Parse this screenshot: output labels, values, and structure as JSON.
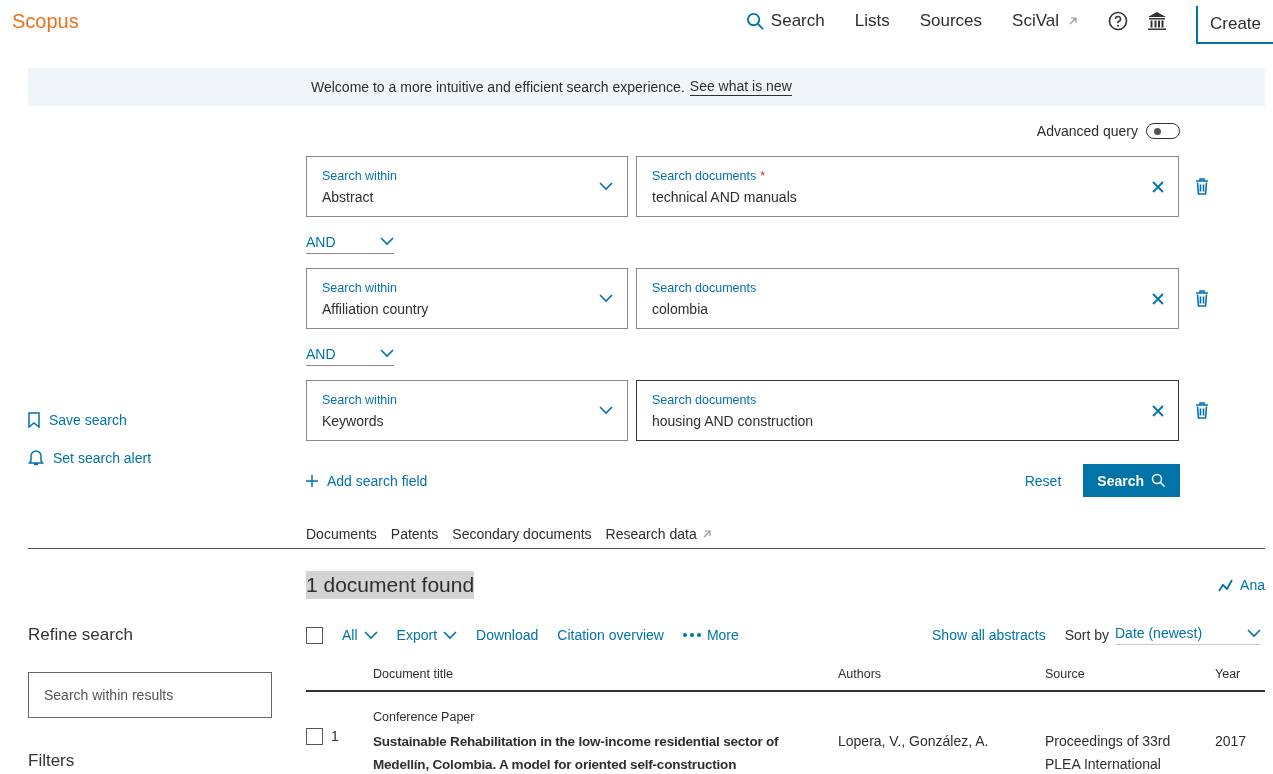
{
  "header": {
    "logo": "Scopus",
    "nav": [
      {
        "label": "Search",
        "kind": "search"
      },
      {
        "label": "Lists",
        "kind": "plain"
      },
      {
        "label": "Sources",
        "kind": "plain"
      },
      {
        "label": "SciVal",
        "kind": "external"
      }
    ],
    "create_button": "Create"
  },
  "banner": {
    "text": "Welcome to a more intuitive and efficient search experience.",
    "link": "See what is new"
  },
  "advanced_query": {
    "label": "Advanced query",
    "on": false
  },
  "search_rows": [
    {
      "operator": null,
      "within_label": "Search within",
      "within_value": "Abstract",
      "field_label": "Search documents",
      "required_mark": "*",
      "value": "technical AND manuals",
      "focused": false
    },
    {
      "operator": "AND",
      "within_label": "Search within",
      "within_value": "Affiliation country",
      "field_label": "Search documents",
      "value": "colombia",
      "focused": false
    },
    {
      "operator": "AND",
      "within_label": "Search within",
      "within_value": "Keywords",
      "field_label": "Search documents",
      "value": "housing AND construction",
      "focused": true
    }
  ],
  "side_actions": [
    {
      "label": "Save search",
      "kind": "bookmark"
    },
    {
      "label": "Set search alert",
      "kind": "bell"
    }
  ],
  "add_field": "Add search field",
  "reset": "Reset",
  "search_button": "Search",
  "doc_tabs": [
    {
      "label": "Documents",
      "kind": "plain"
    },
    {
      "label": "Patents",
      "kind": "plain"
    },
    {
      "label": "Secondary documents",
      "kind": "plain"
    },
    {
      "label": "Research data",
      "kind": "external"
    }
  ],
  "refine": {
    "title": "Refine search",
    "placeholder": "Search within results",
    "filters": "Filters"
  },
  "results": {
    "count": "1 document found",
    "analyze": "Ana",
    "select_all_checked": false,
    "actions": [
      {
        "label": "All",
        "kind": "dropdown"
      },
      {
        "label": "Export",
        "kind": "dropdown"
      },
      {
        "label": "Download",
        "kind": "link"
      },
      {
        "label": "Citation overview",
        "kind": "link"
      },
      {
        "label": "More",
        "kind": "more"
      }
    ],
    "show_all_abstracts": "Show all abstracts",
    "sort_label": "Sort by",
    "sort_value": "Date (newest)",
    "columns": [
      "Document title",
      "Authors",
      "Source",
      "Year"
    ],
    "rows": [
      {
        "checked": false,
        "number": "1",
        "type": "Conference Paper",
        "title": "Sustainable Rehabilitation in the low-income residential sector of Medellín, Colombia. A model for oriented self-construction",
        "authors": "Lopera, V., González, A.",
        "source": "Proceedings of 33rd PLEA International",
        "year": "2017"
      }
    ]
  }
}
